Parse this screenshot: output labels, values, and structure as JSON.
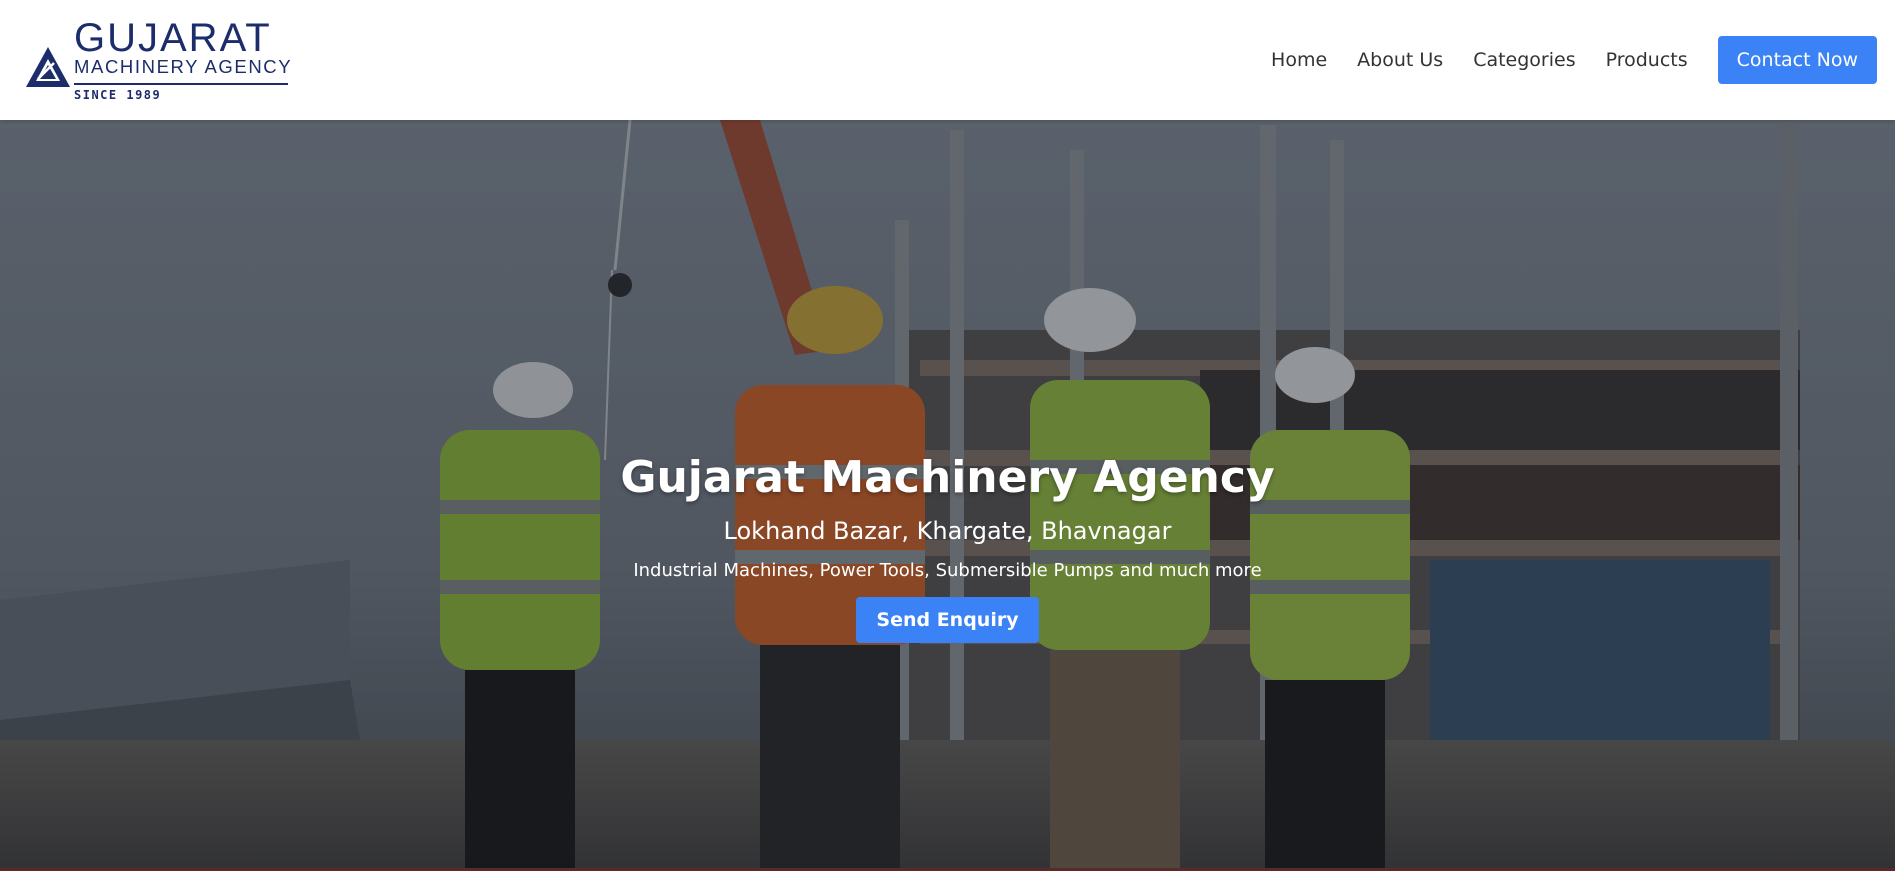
{
  "logo": {
    "name": "GUJARAT",
    "subtitle": "MACHINERY AGENCY",
    "since": "SINCE 1989"
  },
  "nav": {
    "items": [
      {
        "label": "Home"
      },
      {
        "label": "About Us"
      },
      {
        "label": "Categories"
      },
      {
        "label": "Products"
      }
    ],
    "cta_label": "Contact Now"
  },
  "hero": {
    "title": "Gujarat Machinery Agency",
    "address": "Lokhand Bazar, Khargate, Bhavnagar",
    "tagline": "Industrial Machines, Power Tools, Submersible Pumps and much more",
    "button_label": "Send Enquiry"
  },
  "colors": {
    "brand_navy": "#1d2d6b",
    "accent_blue": "#3b82f6",
    "nav_text": "#333333"
  },
  "icons": {
    "logo_mark": "triangle-logo-icon"
  }
}
